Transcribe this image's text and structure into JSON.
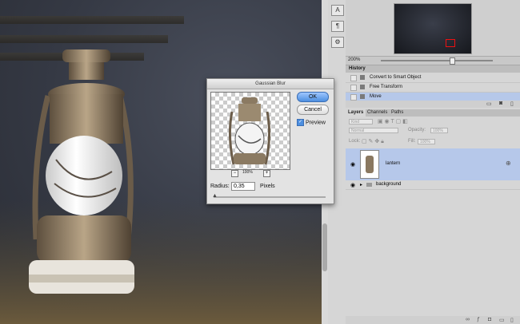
{
  "canvas": {
    "description_icon": "lantern-image"
  },
  "toolstrip": {
    "tools": [
      "A",
      "¶",
      "⚙"
    ]
  },
  "navigator": {
    "zoom": "200%"
  },
  "history": {
    "title": "History",
    "items": [
      {
        "label": "Convert to Smart Object"
      },
      {
        "label": "Free Transform"
      },
      {
        "label": "Move"
      }
    ]
  },
  "layers": {
    "tabs": [
      "Layers",
      "Channels",
      "Paths"
    ],
    "kind": "Kind",
    "mode": "Normal",
    "opacity_label": "Opacity:",
    "opacity_value": "100%",
    "lock_label": "Lock:",
    "fill_label": "Fill:",
    "fill_value": "100%",
    "items": [
      {
        "name": "lantern"
      },
      {
        "name": "background"
      }
    ]
  },
  "dialog": {
    "title": "Gaussian Blur",
    "ok": "OK",
    "cancel": "Cancel",
    "preview_label": "Preview",
    "preview_zoom": "100%",
    "radius_label": "Radius:",
    "radius_value": "0,35",
    "unit": "Pixels"
  },
  "colors": {
    "selection": "#b6c8ea",
    "ok_button": "#4d8fe0"
  }
}
